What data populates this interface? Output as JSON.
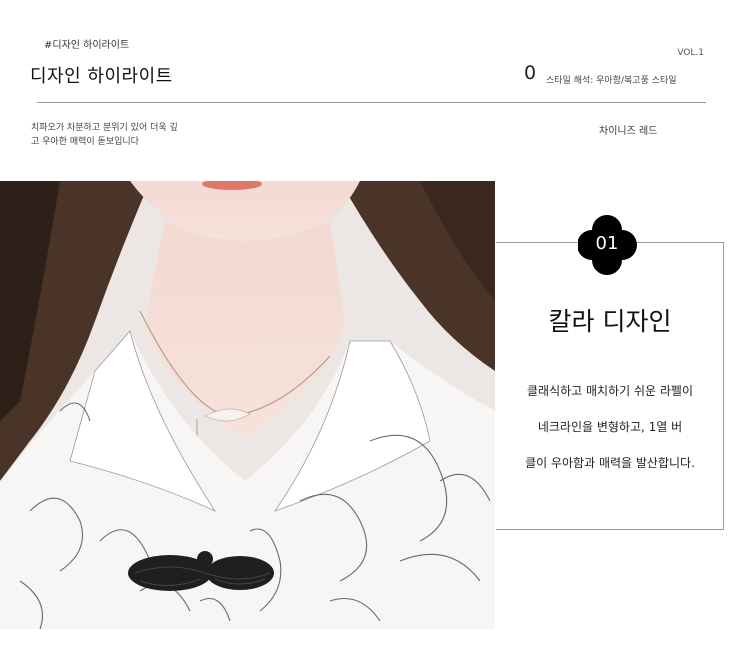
{
  "header": {
    "tag": "#디자인 하이라이트",
    "volume": "VOL.1",
    "title": "디자인 하이라이트",
    "index": "0",
    "style_note": "스타일 해석: 우아함/복고풍 스타일"
  },
  "intro": {
    "line1": "치파오가 차분하고 분위기 있어 더욱 깊",
    "line2": "고 우아한 매력이 돋보입니다",
    "right_note": "차이니즈 레드"
  },
  "feature": {
    "number": "01",
    "title": "칼라 디자인",
    "lines": [
      "클래식하고 매치하기 쉬운 라펠이",
      "네크라인을 변형하고, 1열 버",
      "클이 우아함과 매력을 발산합니다."
    ]
  },
  "colors": {
    "accent": "#000000",
    "rule": "#9a9a9a"
  }
}
